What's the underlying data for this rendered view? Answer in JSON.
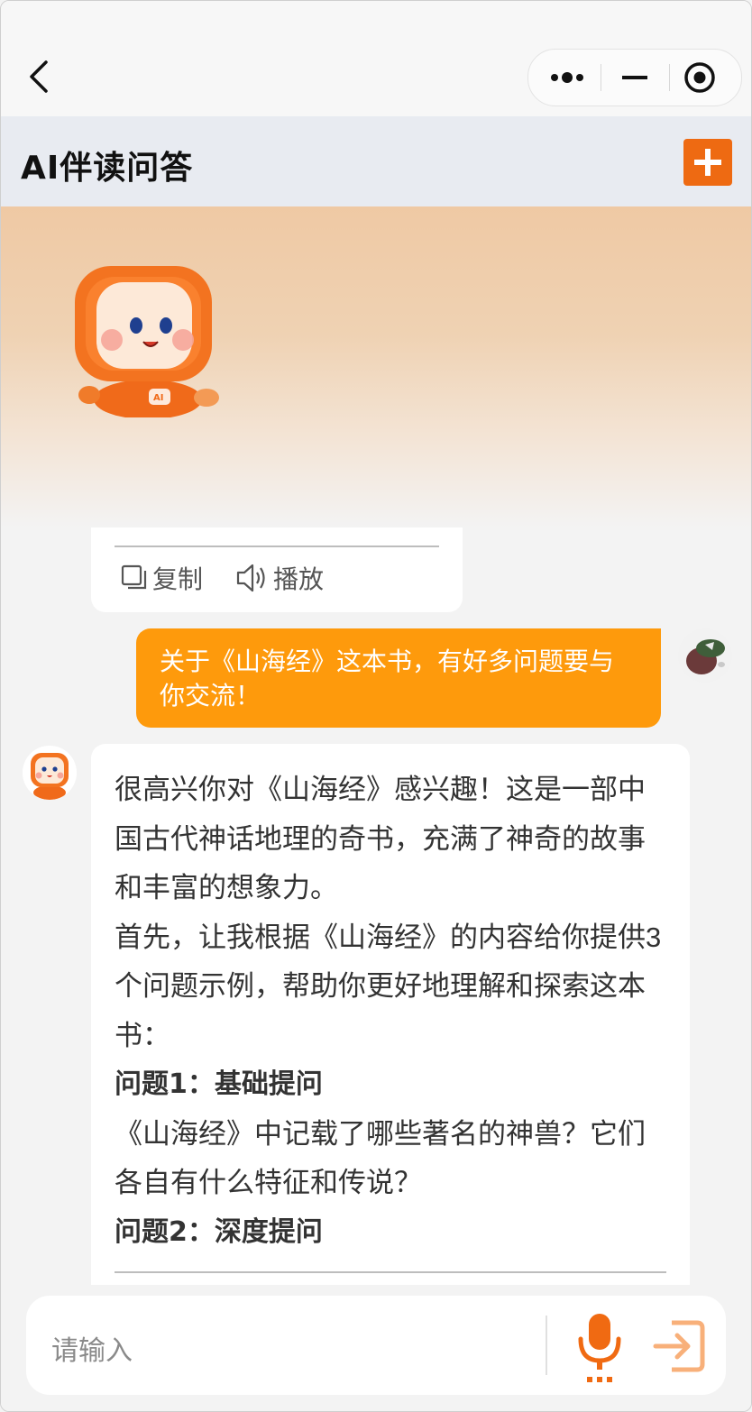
{
  "header": {
    "title": "AI伴读问答",
    "add_label": "+"
  },
  "actions": {
    "copy": "复制",
    "play": "播放"
  },
  "messages": {
    "user": "关于《山海经》这本书，有好多问题要与你交流！",
    "ai": [
      "很高兴你对《山海经》感兴趣！这是一部中国古代神话地理的奇书，充满了神奇的故事和丰富的想象力。",
      "首先，让我根据《山海经》的内容给你提供3个问题示例，帮助你更好地理解和探索这本书：",
      "问题1：基础提问",
      "《山海经》中记载了哪些著名的神兽？它们各自有什么特征和传说？",
      "问题2：深度提问"
    ]
  },
  "input": {
    "placeholder": "请输入"
  },
  "colors": {
    "accent": "#ee6a12",
    "user_bubble": "#fe9a0c"
  },
  "icons": [
    "back-icon",
    "more-icon",
    "minimize-icon",
    "target-icon",
    "plus-icon",
    "copy-icon",
    "speaker-icon",
    "microphone-icon",
    "send-icon"
  ]
}
